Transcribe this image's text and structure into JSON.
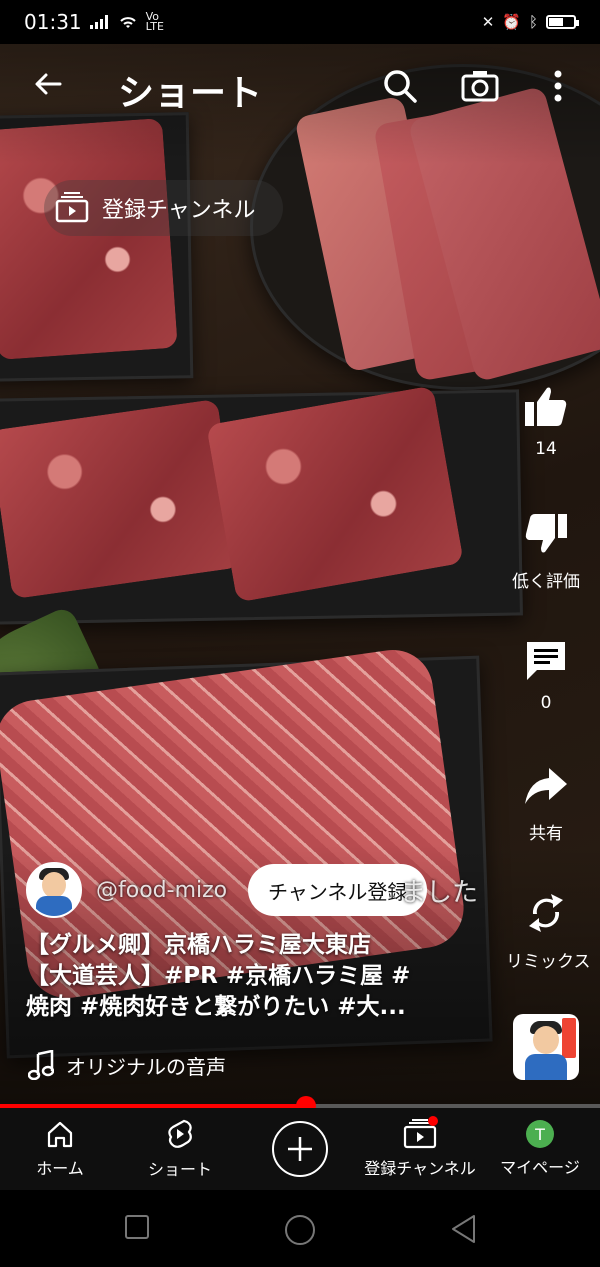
{
  "status_bar": {
    "time": "01:31",
    "left_icons": [
      "signal-icon",
      "wifi-icon",
      "volte-icon"
    ],
    "volte": "Vo LTE",
    "right_icons": [
      "mute-vibrate-icon",
      "alarm-icon",
      "bluetooth-icon",
      "battery-icon"
    ]
  },
  "header": {
    "title": "ショート",
    "icons": [
      "back-arrow-icon",
      "search-icon",
      "camera-icon",
      "more-vert-icon"
    ]
  },
  "subscriptions_pill": {
    "label": "登録チャンネル",
    "icon": "subscriptions-icon"
  },
  "actions": {
    "like": {
      "icon": "thumb-up-icon",
      "label": "14"
    },
    "dislike": {
      "icon": "thumb-down-icon",
      "label": "低く評価"
    },
    "comments": {
      "icon": "comment-icon",
      "label": "0"
    },
    "share": {
      "icon": "share-icon",
      "label": "共有"
    },
    "remix": {
      "icon": "remix-icon",
      "label": "リミックス"
    }
  },
  "channel": {
    "handle": "@food-mizo",
    "subscribe_label": "チャンネル登録",
    "overlay_text": "ました"
  },
  "caption": {
    "line1": "【グルメ卿】京橋ハラミ屋大東店",
    "line2": "【大道芸人】#PR #京橋ハラミ屋 #",
    "line3": "焼肉 #焼肉好きと繋がりたい #大..."
  },
  "sound": {
    "icon": "music-note-icon",
    "label": "オリジナルの音声"
  },
  "progress": {
    "value": 0.51,
    "color": "#ff0000"
  },
  "bottom_nav": {
    "home": "ホーム",
    "shorts": "ショート",
    "create": "",
    "subscriptions": "登録チャンネル",
    "mypage": "マイページ",
    "avatar_letter": "T"
  },
  "system_nav": [
    "recent-apps-icon",
    "home-circle-icon",
    "back-triangle-icon"
  ]
}
